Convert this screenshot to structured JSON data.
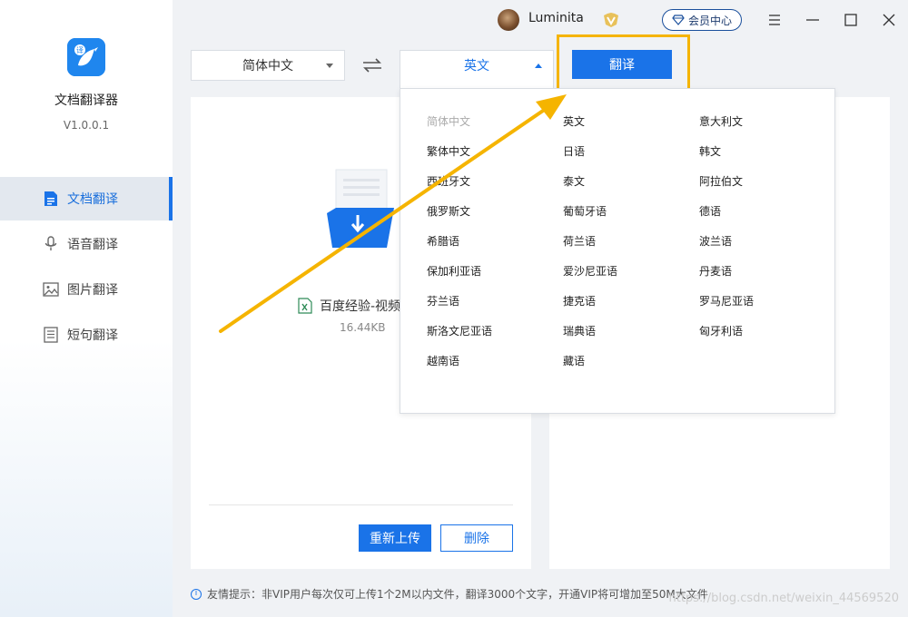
{
  "app": {
    "name": "文档翻译器",
    "version": "V1.0.0.1",
    "logo_char": "译"
  },
  "sidebar": {
    "items": [
      {
        "label": "文档翻译",
        "icon": "document-icon",
        "active": true
      },
      {
        "label": "语音翻译",
        "icon": "microphone-icon",
        "active": false
      },
      {
        "label": "图片翻译",
        "icon": "image-icon",
        "active": false
      },
      {
        "label": "短句翻译",
        "icon": "text-lines-icon",
        "active": false
      }
    ]
  },
  "titlebar": {
    "username": "Luminita",
    "member_label": "会员中心",
    "icons": [
      "avatar",
      "vip-crown-icon",
      "diamond-icon",
      "menu-icon",
      "minimize-icon",
      "maximize-icon",
      "close-icon"
    ]
  },
  "lang_bar": {
    "source": "简体中文",
    "target": "英文",
    "translate_label": "翻译"
  },
  "file": {
    "name": "百度经验-视频",
    "size": "16.44KB"
  },
  "actions": {
    "reupload": "重新上传",
    "delete": "删除"
  },
  "languages": [
    "简体中文",
    "英文",
    "意大利文",
    "繁体中文",
    "日语",
    "韩文",
    "西班牙文",
    "泰文",
    "阿拉伯文",
    "俄罗斯文",
    "葡萄牙语",
    "德语",
    "希腊语",
    "荷兰语",
    "波兰语",
    "保加利亚语",
    "爱沙尼亚语",
    "丹麦语",
    "芬兰语",
    "捷克语",
    "罗马尼亚语",
    "斯洛文尼亚语",
    "瑞典语",
    "匈牙利语",
    "越南语",
    "藏语"
  ],
  "disabled_language": "简体中文",
  "footer": {
    "tip": "友情提示：非VIP用户每次仅可上传1个2M以内文件，翻译3000个文字，开通VIP将可增加至50M大文件",
    "watermark": "https://blog.csdn.net/weixin_44569520"
  },
  "colors": {
    "accent": "#1a73e8",
    "highlight": "#f5b400"
  }
}
